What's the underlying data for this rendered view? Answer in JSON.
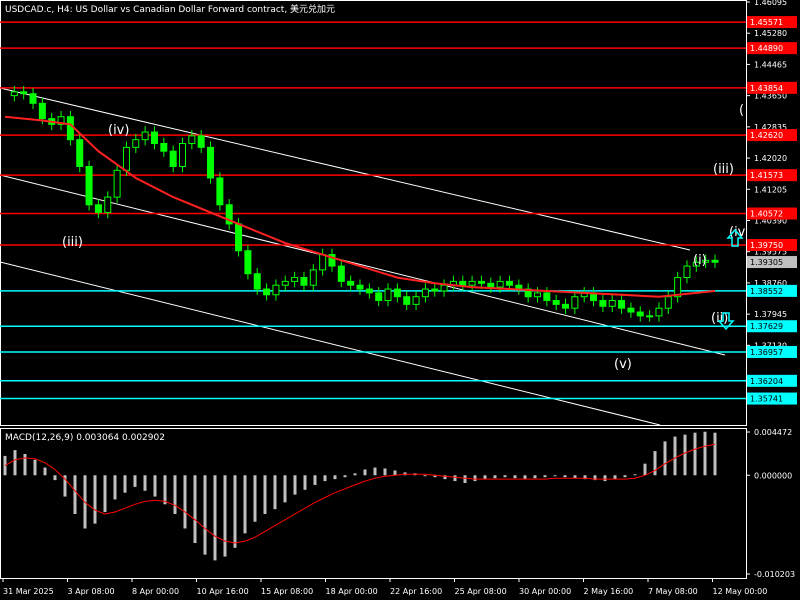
{
  "chart_data": {
    "type": "candlestick",
    "title": "USDCAD.c, H4:  US Dollar vs Canadian Dollar Forward contract, 美元兑加元",
    "current_price": 1.39305,
    "price_axis": {
      "range": [
        1.3505,
        1.46095
      ],
      "ticks": [
        "1.46095",
        "1.45280",
        "1.44465",
        "1.43650",
        "1.42835",
        "1.42020",
        "1.41205",
        "1.40390",
        "1.39575",
        "1.38760",
        "1.37945",
        "1.37130"
      ]
    },
    "time_labels": [
      "31 Mar 2025",
      "3 Apr 08:00",
      "8 Apr 00:00",
      "10 Apr 16:00",
      "15 Apr 08:00",
      "18 Apr 00:00",
      "22 Apr 16:00",
      "25 Apr 08:00",
      "30 Apr 00:00",
      "2 May 16:00",
      "7 May 08:00",
      "12 May 00:00"
    ],
    "resistance_levels": [
      {
        "label": "1.45571",
        "value": 1.45571
      },
      {
        "label": "1.44890",
        "value": 1.4489
      },
      {
        "label": "1.43854",
        "value": 1.43854
      },
      {
        "label": "1.42620",
        "value": 1.4262
      },
      {
        "label": "1.41573",
        "value": 1.41573
      },
      {
        "label": "1.40572",
        "value": 1.40572
      },
      {
        "label": "1.39750",
        "value": 1.3975
      }
    ],
    "support_levels": [
      {
        "label": "1.38552",
        "value": 1.38552
      },
      {
        "label": "1.37629",
        "value": 1.37629
      },
      {
        "label": "1.36957",
        "value": 1.36957
      },
      {
        "label": "1.36204",
        "value": 1.36204
      },
      {
        "label": "1.35741",
        "value": 1.35741
      }
    ],
    "wave_labels": [
      {
        "text": "(iii)"
      },
      {
        "text": "(iv)"
      },
      {
        "text": "(v)"
      },
      {
        "text": "(i)"
      },
      {
        "text": "(ii)"
      },
      {
        "text": "(iii)"
      },
      {
        "text": "(iv"
      },
      {
        "text": "("
      }
    ],
    "price_path": [
      [
        0,
        1.4365
      ],
      [
        1,
        1.4375
      ],
      [
        2,
        1.437
      ],
      [
        3,
        1.4345
      ],
      [
        4,
        1.4305
      ],
      [
        5,
        1.429
      ],
      [
        6,
        1.431
      ],
      [
        7,
        1.425
      ],
      [
        8,
        1.418
      ],
      [
        9,
        1.408
      ],
      [
        10,
        1.406
      ],
      [
        11,
        1.41
      ],
      [
        12,
        1.417
      ],
      [
        13,
        1.423
      ],
      [
        14,
        1.425
      ],
      [
        15,
        1.427
      ],
      [
        16,
        1.424
      ],
      [
        17,
        1.422
      ],
      [
        18,
        1.418
      ],
      [
        19,
        1.424
      ],
      [
        20,
        1.426
      ],
      [
        21,
        1.423
      ],
      [
        22,
        1.415
      ],
      [
        23,
        1.408
      ],
      [
        24,
        1.403
      ],
      [
        25,
        1.396
      ],
      [
        26,
        1.39
      ],
      [
        27,
        1.386
      ],
      [
        28,
        1.3845
      ],
      [
        29,
        1.387
      ],
      [
        30,
        1.388
      ],
      [
        31,
        1.389
      ],
      [
        32,
        1.387
      ],
      [
        33,
        1.391
      ],
      [
        34,
        1.395
      ],
      [
        35,
        1.392
      ],
      [
        36,
        1.388
      ],
      [
        37,
        1.387
      ],
      [
        38,
        1.386
      ],
      [
        39,
        1.385
      ],
      [
        40,
        1.383
      ],
      [
        41,
        1.386
      ],
      [
        42,
        1.384
      ],
      [
        43,
        1.382
      ],
      [
        44,
        1.384
      ],
      [
        45,
        1.386
      ],
      [
        46,
        1.3855
      ],
      [
        47,
        1.387
      ],
      [
        48,
        1.388
      ],
      [
        49,
        1.387
      ],
      [
        50,
        1.388
      ],
      [
        51,
        1.3875
      ],
      [
        52,
        1.3865
      ],
      [
        53,
        1.388
      ],
      [
        54,
        1.387
      ],
      [
        55,
        1.386
      ],
      [
        56,
        1.384
      ],
      [
        57,
        1.385
      ],
      [
        58,
        1.383
      ],
      [
        59,
        1.382
      ],
      [
        60,
        1.381
      ],
      [
        61,
        1.384
      ],
      [
        62,
        1.385
      ],
      [
        63,
        1.383
      ],
      [
        64,
        1.3815
      ],
      [
        65,
        1.383
      ],
      [
        66,
        1.381
      ],
      [
        67,
        1.38
      ],
      [
        68,
        1.379
      ],
      [
        69,
        1.379
      ],
      [
        70,
        1.381
      ],
      [
        71,
        1.384
      ],
      [
        72,
        1.389
      ],
      [
        73,
        1.392
      ],
      [
        74,
        1.393
      ],
      [
        75,
        1.3935
      ],
      [
        76,
        1.393
      ]
    ],
    "moving_average": [
      [
        0,
        1.431
      ],
      [
        4,
        1.43
      ],
      [
        7,
        1.429
      ],
      [
        10,
        1.422
      ],
      [
        14,
        1.415
      ],
      [
        18,
        1.41
      ],
      [
        22,
        1.406
      ],
      [
        26,
        1.402
      ],
      [
        30,
        1.398
      ],
      [
        34,
        1.395
      ],
      [
        38,
        1.392
      ],
      [
        42,
        1.389
      ],
      [
        46,
        1.3875
      ],
      [
        50,
        1.3865
      ],
      [
        54,
        1.386
      ],
      [
        58,
        1.3855
      ],
      [
        62,
        1.385
      ],
      [
        66,
        1.3845
      ],
      [
        70,
        1.384
      ],
      [
        74,
        1.385
      ],
      [
        76,
        1.3855
      ]
    ],
    "macd": {
      "label": "MACD(12,26,9) 0.003064 0.002902",
      "range": [
        -0.010203,
        0.004472
      ],
      "ticks": [
        "0.004472",
        "0.000000",
        "-0.010203"
      ],
      "histogram": [
        0.002,
        0.0026,
        0.0022,
        0.0016,
        0.0008,
        -0.0005,
        -0.0022,
        -0.004,
        -0.0055,
        -0.005,
        -0.0038,
        -0.0025,
        -0.0018,
        -0.0012,
        -0.0016,
        -0.0022,
        -0.003,
        -0.004,
        -0.0055,
        -0.007,
        -0.0082,
        -0.0088,
        -0.0084,
        -0.0075,
        -0.006,
        -0.0048,
        -0.004,
        -0.0035,
        -0.0028,
        -0.002,
        -0.0015,
        -0.001,
        -0.0006,
        -0.0004,
        -0.0002,
        0.0002,
        0.0006,
        0.0008,
        0.0007,
        0.0005,
        0.0003,
        0.0002,
        0.0,
        -0.0002,
        -0.0004,
        -0.0006,
        -0.0008,
        -0.0006,
        -0.0004,
        -0.0003,
        -0.0002,
        -0.0003,
        -0.0004,
        -0.0003,
        -0.0002,
        -0.0001,
        -0.0002,
        -0.0003,
        -0.0004,
        -0.0005,
        -0.0006,
        -0.0004,
        -0.0002,
        0.0001,
        0.0012,
        0.0025,
        0.0035,
        0.004,
        0.0042,
        0.0044,
        0.0045,
        0.0044
      ],
      "signal": [
        0.001,
        0.0016,
        0.0018,
        0.0017,
        0.0013,
        0.0006,
        -0.0004,
        -0.0016,
        -0.0028,
        -0.0036,
        -0.004,
        -0.0038,
        -0.0034,
        -0.003,
        -0.0027,
        -0.0026,
        -0.0027,
        -0.0031,
        -0.0038,
        -0.0046,
        -0.0055,
        -0.0063,
        -0.0068,
        -0.007,
        -0.0068,
        -0.0064,
        -0.0058,
        -0.0052,
        -0.0046,
        -0.004,
        -0.0034,
        -0.0028,
        -0.0023,
        -0.0018,
        -0.0014,
        -0.001,
        -0.0006,
        -0.0003,
        -0.0001,
        0.0,
        0.0001,
        0.0001,
        0.0001,
        0.0,
        -0.0001,
        -0.0002,
        -0.0003,
        -0.0004,
        -0.0004,
        -0.0004,
        -0.0004,
        -0.0004,
        -0.0004,
        -0.0004,
        -0.0004,
        -0.0003,
        -0.0003,
        -0.0003,
        -0.0003,
        -0.0004,
        -0.0004,
        -0.0004,
        -0.0004,
        -0.0003,
        0.0,
        0.0005,
        0.0012,
        0.0018,
        0.0023,
        0.0027,
        0.003,
        0.0032
      ]
    },
    "colors": {
      "background": "#000000",
      "axis": "#ffffff",
      "resistance": "#ff0000",
      "support": "#00ffff",
      "bull_candle": "#00ff00",
      "bear_candle": "#00ff00",
      "moving_average": "#ff2020",
      "channel": "#ffffff",
      "macd_hist": "#c0c0c0",
      "macd_signal": "#ff0000",
      "arrow": "#00ffff"
    },
    "grid": false
  }
}
